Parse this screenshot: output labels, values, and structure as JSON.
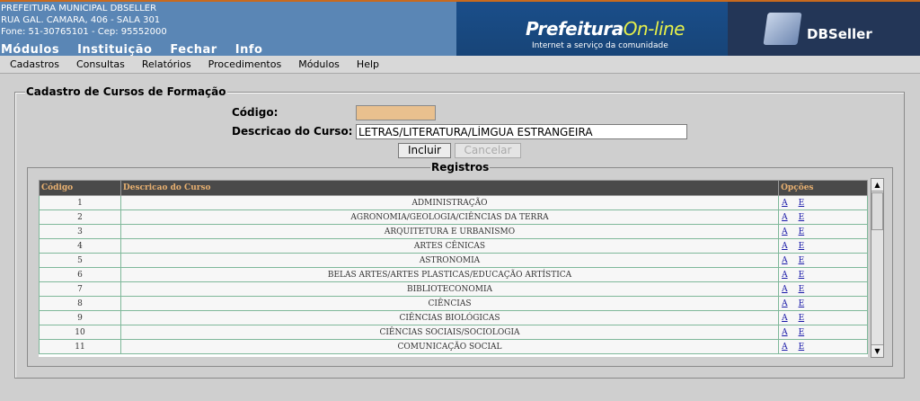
{
  "header": {
    "org_line1": "PREFEITURA MUNICIPAL DBSELLER",
    "org_line2": "RUA GAL. CAMARA, 406 - SALA 301",
    "org_line3": "Fone: 51-30765101  -  Cep: 95552000",
    "main_menu": [
      "Módulos",
      "Instituição",
      "Fechar",
      "Info"
    ],
    "banner_title_a": "Prefeitura",
    "banner_title_b": "On-line",
    "banner_subtitle": "Internet a serviço da comunidade",
    "vendor": "DBSeller"
  },
  "menubar": [
    "Cadastros",
    "Consultas",
    "Relatórios",
    "Procedimentos",
    "Módulos",
    "Help"
  ],
  "form": {
    "legend": "Cadastro de Cursos de Formação",
    "codigo_label": "Código:",
    "codigo_value": "",
    "descricao_label": "Descricao do Curso:",
    "descricao_value": "LETRAS/LITERATURA/LÍMGUA ESTRANGEIRA",
    "incluir_label": "Incluir",
    "cancelar_label": "Cancelar"
  },
  "registros": {
    "legend": "Registros",
    "columns": [
      "Código",
      "Descricao do Curso",
      "Opções"
    ],
    "option_alter": "A",
    "option_exclude": "E",
    "rows": [
      {
        "codigo": "1",
        "descricao": "ADMINISTRAÇÃO"
      },
      {
        "codigo": "2",
        "descricao": "AGRONOMIA/GEOLOGIA/CIÊNCIAS DA TERRA"
      },
      {
        "codigo": "3",
        "descricao": "ARQUITETURA E URBANISMO"
      },
      {
        "codigo": "4",
        "descricao": "ARTES CÊNICAS"
      },
      {
        "codigo": "5",
        "descricao": "ASTRONOMIA"
      },
      {
        "codigo": "6",
        "descricao": "BELAS ARTES/ARTES PLASTICAS/EDUCAÇÃO ARTÍSTICA"
      },
      {
        "codigo": "7",
        "descricao": "BIBLIOTECONOMIA"
      },
      {
        "codigo": "8",
        "descricao": "CIÊNCIAS"
      },
      {
        "codigo": "9",
        "descricao": "CIÊNCIAS BIOLÓGICAS"
      },
      {
        "codigo": "10",
        "descricao": "CIÊNCIAS SOCIAIS/SOCIOLOGIA"
      },
      {
        "codigo": "11",
        "descricao": "COMUNICAÇÃO SOCIAL"
      }
    ]
  }
}
